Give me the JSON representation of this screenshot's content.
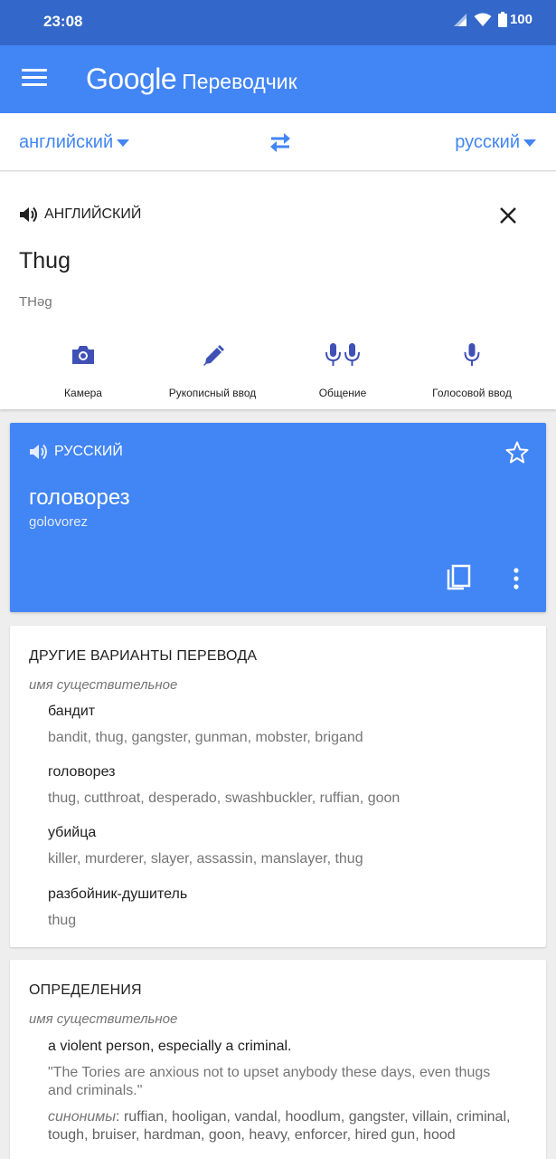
{
  "status": {
    "time": "23:08",
    "battery": "100"
  },
  "appbar": {
    "brand": "Google",
    "product": "Переводчик"
  },
  "languages": {
    "source": "английский",
    "target": "русский"
  },
  "input": {
    "language_label": "АНГЛИЙСКИЙ",
    "text": "Thug",
    "transliteration": "THəg",
    "tools": [
      {
        "icon": "camera-icon",
        "label": "Камера"
      },
      {
        "icon": "handwriting-icon",
        "label": "Рукописный ввод"
      },
      {
        "icon": "conversation-icon",
        "label": "Общение"
      },
      {
        "icon": "voice-input-icon",
        "label": "Голосовой ввод"
      }
    ]
  },
  "result": {
    "language_label": "РУССКИЙ",
    "text": "головорез",
    "transliteration": "golovorez"
  },
  "alternatives": {
    "title": "ДРУГИЕ ВАРИАНТЫ ПЕРЕВОДА",
    "pos": "имя существительное",
    "entries": [
      {
        "word": "бандит",
        "synonyms": "bandit, thug, gangster, gunman, mobster, brigand"
      },
      {
        "word": "головорез",
        "synonyms": "thug, cutthroat, desperado, swashbuckler, ruffian, goon"
      },
      {
        "word": "убийца",
        "synonyms": "killer, murderer, slayer, assassin, manslayer, thug"
      },
      {
        "word": "разбойник-душитель",
        "synonyms": "thug"
      }
    ]
  },
  "definitions": {
    "title": "ОПРЕДЕЛЕНИЯ",
    "pos": "имя существительное",
    "definition": "a violent person, especially a criminal.",
    "example": "\"The Tories are anxious not to upset anybody these days, even thugs and criminals.\"",
    "synonyms_label": "синонимы",
    "synonyms": ": ruffian, hooligan, vandal, hoodlum, gangster, villain, criminal, tough, bruiser, hardman, goon, heavy, enforcer, hired gun, hood"
  },
  "colors": {
    "primary": "#4285f4",
    "status_bar": "#3367c9",
    "tool_icon": "#3f51b5"
  }
}
